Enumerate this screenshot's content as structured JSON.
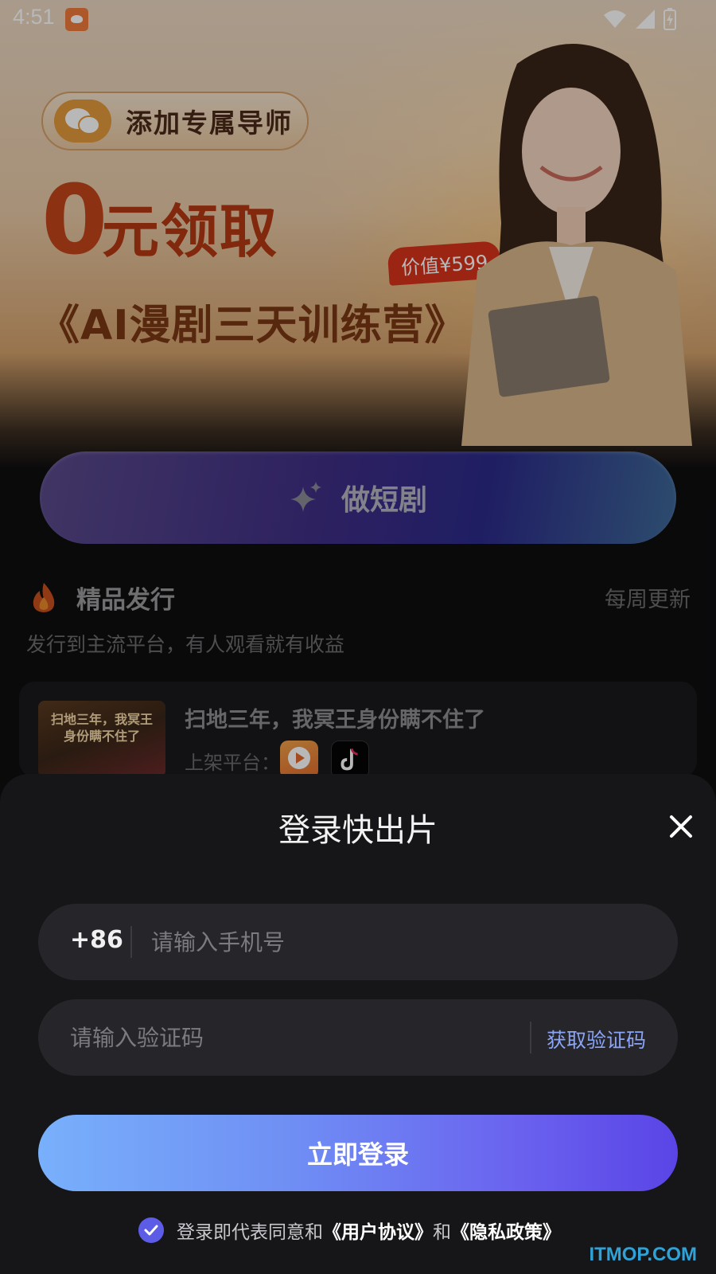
{
  "status_bar": {
    "time": "4:51"
  },
  "banner": {
    "mentor_label": "添加专属导师",
    "promo_zero": "0",
    "promo_free": "元领取",
    "price_badge": "价值¥599",
    "camp_title": "《AI漫剧三天训练营》"
  },
  "make_button": {
    "label": "做短剧"
  },
  "releases": {
    "title": "精品发行",
    "update_note": "每周更新",
    "subtitle": "发行到主流平台，有人观看就有收益",
    "card": {
      "thumb_text": "扫地三年，我冥王身份瞒不住了",
      "title": "扫地三年，我冥王身份瞒不住了",
      "platform_label": "上架平台："
    }
  },
  "login_sheet": {
    "title": "登录快出片",
    "country_code": "+86",
    "phone_placeholder": "请输入手机号",
    "code_placeholder": "请输入验证码",
    "get_code_label": "获取验证码",
    "login_label": "立即登录",
    "agree_prefix": "登录即代表同意和",
    "user_agreement": "《用户协议》",
    "and": "和",
    "privacy_policy": "《隐私政策》"
  },
  "watermark": "ITMOP.COM",
  "colors": {
    "accent": "#6a62ef",
    "link": "#8aa4f6",
    "sheet_bg": "#161618"
  },
  "icons": [
    "wifi-icon",
    "signal-icon",
    "battery-icon",
    "wechat-icon",
    "sparkle-icon",
    "fire-icon",
    "close-icon",
    "check-icon"
  ]
}
